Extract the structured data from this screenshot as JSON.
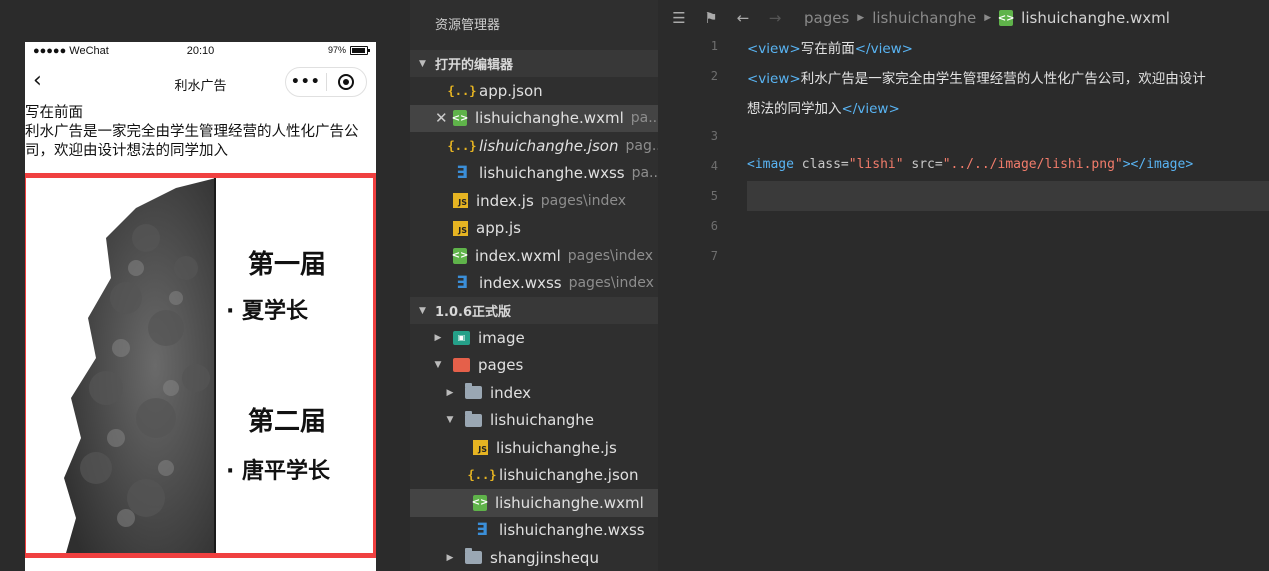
{
  "simulator": {
    "status": {
      "signal": "●●●●● WeChat",
      "time": "20:10",
      "battery": "97%"
    },
    "nav": {
      "back_glyph": "‹",
      "title": "利水广告",
      "more": "•••"
    },
    "page": {
      "line1": "写在前面",
      "line2a": "利水广告是一家完全由学生管理经营的人性化广告公",
      "line2b": "司，欢迎由设计想法的同学加入"
    },
    "poster": {
      "heading1": "第一届",
      "name1": "· 夏学长",
      "heading2": "第二届",
      "name2": "· 唐平学长",
      "border_color": "#f04040"
    }
  },
  "explorer": {
    "title": "资源管理器",
    "open_editors_label": "打开的编辑器",
    "open_editors": [
      {
        "name": "app.json",
        "path": "",
        "icon": "json-icon"
      },
      {
        "name": "lishuichanghe.wxml",
        "path": "pa...",
        "icon": "wxml-icon"
      },
      {
        "name": "lishuichanghe.json",
        "path": "pag...",
        "icon": "json-icon"
      },
      {
        "name": "lishuichanghe.wxss",
        "path": "pa...",
        "icon": "wxss-icon"
      },
      {
        "name": "index.js",
        "path": "pages\\index",
        "icon": "js-icon"
      },
      {
        "name": "app.js",
        "path": "",
        "icon": "js-icon"
      },
      {
        "name": "index.wxml",
        "path": "pages\\index",
        "icon": "wxml-icon"
      },
      {
        "name": "index.wxss",
        "path": "pages\\index",
        "icon": "wxss-icon"
      }
    ],
    "project_label": "1.0.6正式版",
    "tree": {
      "image": "image",
      "pages": "pages",
      "index": "index",
      "lishuichanghe": "lishuichanghe",
      "files": [
        "lishuichanghe.js",
        "lishuichanghe.json",
        "lishuichanghe.wxml",
        "lishuichanghe.wxss"
      ],
      "shangjinshequ": "shangjinshequ"
    }
  },
  "editor": {
    "breadcrumb": {
      "c1": "pages",
      "c2": "lishuichanghe",
      "c3": "lishuichanghe.wxml"
    },
    "line_numbers": [
      "1",
      "2",
      "3",
      "4",
      "5",
      "6",
      "7"
    ],
    "code": {
      "l1_open": "<view>",
      "l1_text": "写在前面",
      "l1_close": "</view>",
      "l2_open": "<view>",
      "l2_text": "利水广告是一家完全由学生管理经营的人性化广告公司，欢迎由设计",
      "l2b_text": "想法的同学加入",
      "l2_close": "</view>",
      "l4_tag_open": "<image",
      "l4_attr1": "class=",
      "l4_val1": "\"lishi\"",
      "l4_attr2": "src=",
      "l4_val2": "\"../../image/lishi.png\"",
      "l4_end": "></image>"
    }
  }
}
